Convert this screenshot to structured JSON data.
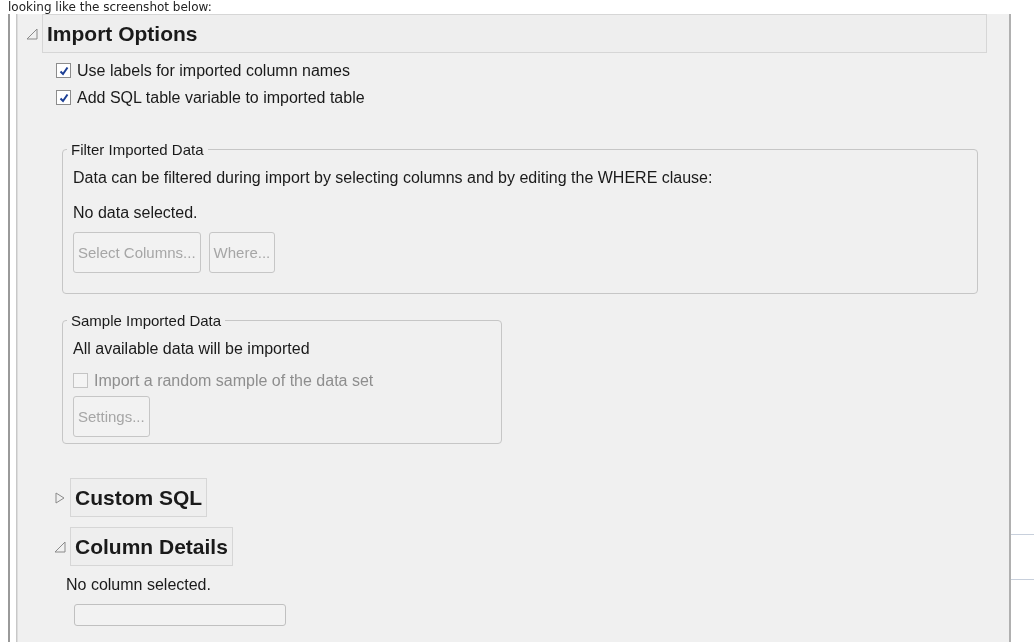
{
  "caption": "looking like the screenshot below:",
  "import_options": {
    "title": "Import Options",
    "expanded": true,
    "checkboxes": [
      {
        "label": "Use labels for imported column names",
        "checked": true,
        "disabled": false
      },
      {
        "label": "Add SQL table variable to imported table",
        "checked": true,
        "disabled": false
      }
    ],
    "filter_group": {
      "title": "Filter Imported Data",
      "description": "Data can be filtered during import by selecting columns and by editing the WHERE clause:",
      "status": "No data selected.",
      "buttons": [
        {
          "label": "Select Columns...",
          "disabled": true
        },
        {
          "label": "Where...",
          "disabled": true
        }
      ]
    },
    "sample_group": {
      "title": "Sample Imported Data",
      "description": "All available data will be imported",
      "checkbox": {
        "label": "Import a random sample of the data set",
        "checked": false,
        "disabled": true
      },
      "buttons": [
        {
          "label": "Settings...",
          "disabled": true
        }
      ]
    },
    "custom_sql": {
      "title": "Custom SQL",
      "expanded": false
    }
  },
  "column_details": {
    "title": "Column Details",
    "expanded": true,
    "status": "No column selected."
  }
}
